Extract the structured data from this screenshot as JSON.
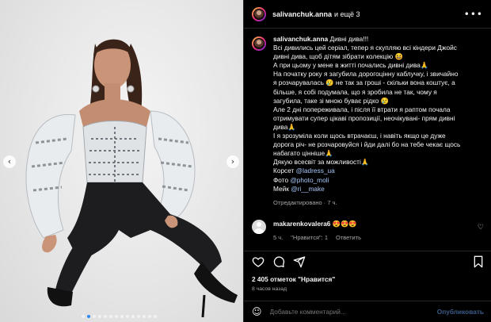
{
  "header": {
    "username": "salivanchuk.anna",
    "rest": "и ещё 3",
    "more_icon": "more-horizontal-icon"
  },
  "caption": {
    "username": "salivanchuk.anna",
    "lines": [
      "Дивні дива!!!",
      "Всі дивились цей серіал, тепер я скупляю всі кіндери Джойс",
      "дивні дива, щоб дітям зібрати колекцію 😆",
      "А при цьому у мене в житті почались дивні дива🙏",
      "На початку року я загубила дорогоцінну каблучку, і звичайно",
      "я розчарувалась 😢 не так за гроші - скільки вона коштує, а",
      "більше, я собі подумала, що я зробила не так, чому я",
      "загубила, таке зі мною буває рідко 😢",
      "Але 2 дні попереживала, і після її втрати я раптом почала",
      "отримувати супер цікаві пропозиції, неочікувані- прям дивні",
      "дива🙏",
      "І я зрозуміла коли щось втрачаєш, і навіть якщо це дуже",
      "дорога річ- не розчаровуйся і йди далі бо на тебе чекає щось",
      "набагато цінніше🙏",
      "Дякую всесвіт за можливості🙏"
    ],
    "credits": [
      {
        "label": "Корсет",
        "tag": "@ladress_ua"
      },
      {
        "label": "Фото",
        "tag": "@photo_moli"
      },
      {
        "label": "Мейк",
        "tag": "@ri__make"
      }
    ],
    "meta": "Отредактировано · 7 ч."
  },
  "comment": {
    "username": "makarenkovalera6",
    "text": "😍😍😍",
    "time": "5 ч.",
    "likes_label": "\"Нравится\": 1",
    "reply_label": "Ответить"
  },
  "actions": {
    "likes_text": "2 405 отметок \"Нравится\"",
    "time": "8 часов назад"
  },
  "add_comment": {
    "emoji": "☺",
    "placeholder": "Добавьте комментарий...",
    "publish": "Опубликовать"
  },
  "nav": {
    "prev": "‹",
    "next": "›"
  },
  "carousel": {
    "slides": 14,
    "active_index": 1
  },
  "colors": {
    "background": "#000000",
    "secondary_text": "#a8a8a8",
    "tag": "#a8c7fa",
    "publish": "#3c5a87",
    "active_dot": "#2b8aef"
  }
}
